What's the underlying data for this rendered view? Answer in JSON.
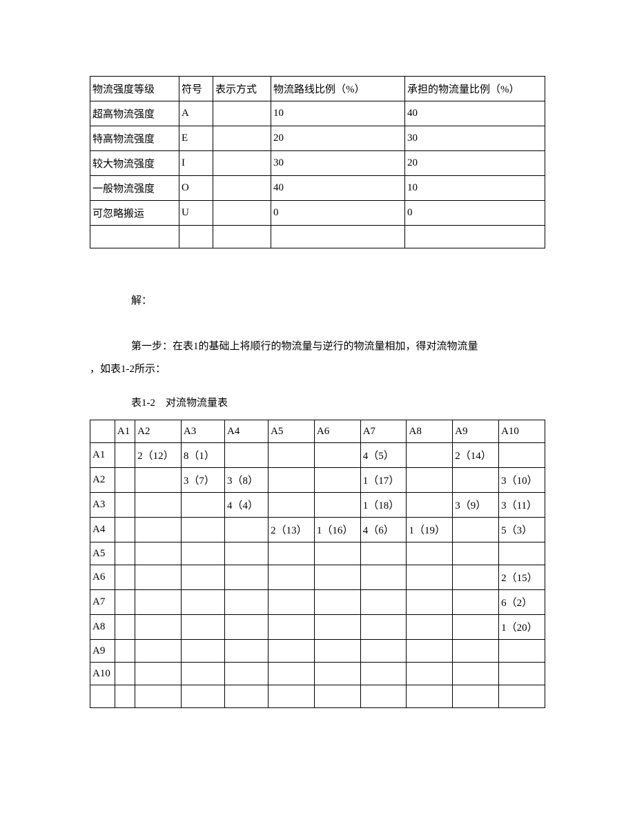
{
  "table1": {
    "headers": [
      "物流强度等级",
      "符号",
      "表示方式",
      "物流路线比例（%）",
      "承担的物流量比例（%）"
    ],
    "rows": [
      [
        "超高物流强度",
        "A",
        "",
        "10",
        "40"
      ],
      [
        "特高物流强度",
        "E",
        "",
        "20",
        "30"
      ],
      [
        "较大物流强度",
        "I",
        "",
        "30",
        "20"
      ],
      [
        "一般物流强度",
        "O",
        "",
        "40",
        "10"
      ],
      [
        "可忽略搬运",
        "U",
        "",
        "0",
        "0"
      ],
      [
        "",
        "",
        "",
        "",
        ""
      ]
    ]
  },
  "para_solution": "解：",
  "para_step1_line1": "第一步：在表1的基础上将顺行的物流量与逆行的物流量相加，得对流物流量",
  "para_step1_line2": "，如表1-2所示：",
  "table2_caption": "表1-2　对流物流量表",
  "table2": {
    "headers": [
      "",
      "A1",
      "A2",
      "A3",
      "A4",
      "A5",
      "A6",
      "A7",
      "A8",
      "A9",
      "A10"
    ],
    "rows": [
      [
        "A1",
        "",
        "2（12）",
        "8（1）",
        "",
        "",
        "",
        "4（5）",
        "",
        "2（14）",
        ""
      ],
      [
        "A2",
        "",
        "",
        "3（7）",
        "3（8）",
        "",
        "",
        "1（17）",
        "",
        "",
        "3（10）"
      ],
      [
        "A3",
        "",
        "",
        "",
        "4（4）",
        "",
        "",
        "1（18）",
        "",
        "3（9）",
        "3（11）"
      ],
      [
        "A4",
        "",
        "",
        "",
        "",
        "2（13）",
        "1（16）",
        "4（6）",
        "1（19）",
        "",
        "5（3）"
      ],
      [
        "A5",
        "",
        "",
        "",
        "",
        "",
        "",
        "",
        "",
        "",
        ""
      ],
      [
        "A6",
        "",
        "",
        "",
        "",
        "",
        "",
        "",
        "",
        "",
        "2（15）"
      ],
      [
        "A7",
        "",
        "",
        "",
        "",
        "",
        "",
        "",
        "",
        "",
        "6（2）"
      ],
      [
        "A8",
        "",
        "",
        "",
        "",
        "",
        "",
        "",
        "",
        "",
        "1（20）"
      ],
      [
        "A9",
        "",
        "",
        "",
        "",
        "",
        "",
        "",
        "",
        "",
        ""
      ],
      [
        "A10",
        "",
        "",
        "",
        "",
        "",
        "",
        "",
        "",
        "",
        ""
      ],
      [
        "",
        "",
        "",
        "",
        "",
        "",
        "",
        "",
        "",
        "",
        ""
      ]
    ]
  }
}
